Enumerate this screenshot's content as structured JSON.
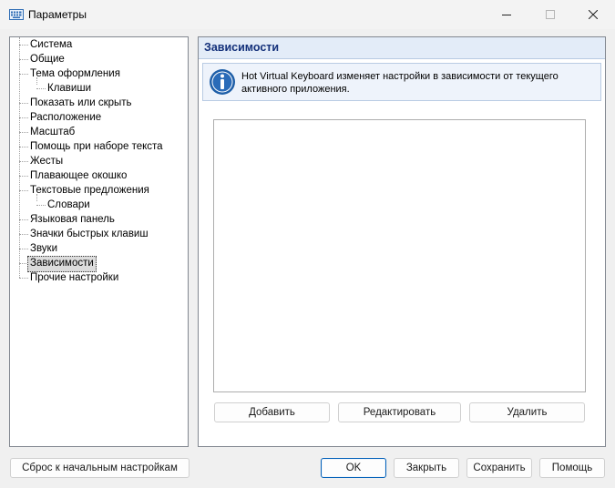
{
  "window": {
    "title": "Параметры"
  },
  "tree": {
    "items": [
      {
        "label": "Система"
      },
      {
        "label": "Общие"
      },
      {
        "label": "Тема оформления"
      },
      {
        "label": "Клавиши"
      },
      {
        "label": "Показать или скрыть"
      },
      {
        "label": "Расположение"
      },
      {
        "label": "Масштаб"
      },
      {
        "label": "Помощь при наборе текста"
      },
      {
        "label": "Жесты"
      },
      {
        "label": "Плавающее окошко"
      },
      {
        "label": "Текстовые предложения"
      },
      {
        "label": "Словари"
      },
      {
        "label": "Языковая панель"
      },
      {
        "label": "Значки быстрых клавиш"
      },
      {
        "label": "Звуки"
      },
      {
        "label": "Зависимости"
      },
      {
        "label": "Прочие настройки"
      }
    ],
    "selected": "Зависимости"
  },
  "panel": {
    "title": "Зависимости",
    "info": "Hot Virtual Keyboard изменяет настройки в зависимости от текущего активного приложения.",
    "buttons": {
      "add": "Добавить",
      "edit": "Редактировать",
      "delete": "Удалить"
    }
  },
  "footer": {
    "reset": "Сброс к начальным настройкам",
    "ok": "OK",
    "close": "Закрыть",
    "save": "Сохранить",
    "help": "Помощь"
  },
  "colors": {
    "accent": "#005fb8",
    "header_bg": "#e3ecf8",
    "header_text": "#13307a",
    "info_icon": "#1f5fa8"
  },
  "icons": {
    "app": "keyboard-icon",
    "info": "info-icon"
  }
}
